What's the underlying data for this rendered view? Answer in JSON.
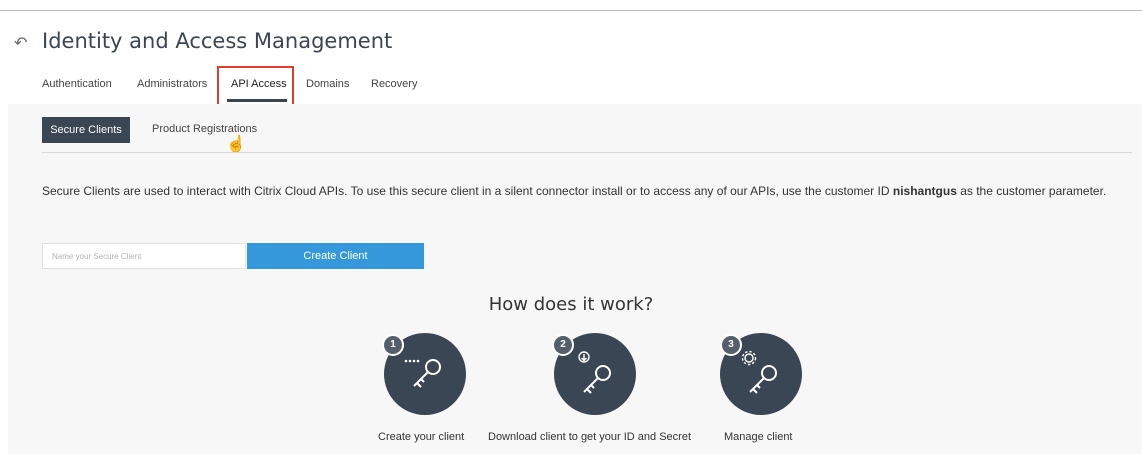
{
  "header": {
    "title": "Identity and Access Management"
  },
  "tabs": [
    {
      "label": "Authentication"
    },
    {
      "label": "Administrators"
    },
    {
      "label": "API Access"
    },
    {
      "label": "Domains"
    },
    {
      "label": "Recovery"
    }
  ],
  "subtabs": {
    "secure_clients": "Secure Clients",
    "product_registrations": "Product Registrations"
  },
  "description": {
    "before": "Secure Clients are used to interact with Citrix Cloud APIs. To use this secure client in a silent connector install or to access any of our APIs, use the customer ID ",
    "customer_id": "nishantgus",
    "after": " as the customer parameter."
  },
  "form": {
    "placeholder": "Name your Secure Client",
    "create_label": "Create Client"
  },
  "how": {
    "title": "How does it work?",
    "steps": [
      {
        "number": "1",
        "label": "Create your client",
        "icon": "key-dots-icon"
      },
      {
        "number": "2",
        "label": "Download client to get your ID and Secret",
        "icon": "key-download-icon"
      },
      {
        "number": "3",
        "label": "Manage client",
        "icon": "key-gear-icon"
      }
    ]
  },
  "colors": {
    "primary_dark": "#3b4654",
    "accent_blue": "#3498db",
    "highlight_red": "#e53b2e"
  }
}
